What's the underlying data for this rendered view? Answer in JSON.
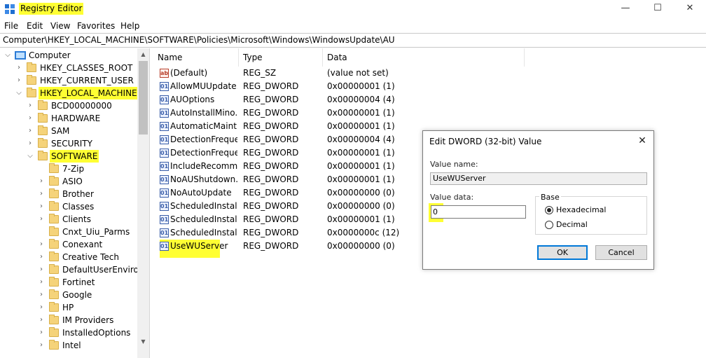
{
  "window": {
    "title": "Registry Editor",
    "minimize": "—",
    "maximize": "☐",
    "close": "✕"
  },
  "menu": [
    "File",
    "Edit",
    "View",
    "Favorites",
    "Help"
  ],
  "address": "Computer\\HKEY_LOCAL_MACHINE\\SOFTWARE\\Policies\\Microsoft\\Windows\\WindowsUpdate\\AU",
  "tree": {
    "root": "Computer",
    "hives": [
      "HKEY_CLASSES_ROOT",
      "HKEY_CURRENT_USER",
      "HKEY_LOCAL_MACHINE"
    ],
    "hklm_children": [
      "BCD00000000",
      "HARDWARE",
      "SAM",
      "SECURITY",
      "SOFTWARE"
    ],
    "software_children": [
      "7-Zip",
      "ASIO",
      "Brother",
      "Classes",
      "Clients",
      "Cnxt_Uiu_Parms",
      "Conexant",
      "Creative Tech",
      "DefaultUserEnvironn",
      "Fortinet",
      "Google",
      "HP",
      "IM Providers",
      "InstalledOptions",
      "Intel"
    ]
  },
  "columns": {
    "name": "Name",
    "type": "Type",
    "data": "Data"
  },
  "values": [
    {
      "name": "(Default)",
      "type": "REG_SZ",
      "data": "(value not set)",
      "icon": "string-value-icon"
    },
    {
      "name": "AllowMUUpdate...",
      "type": "REG_DWORD",
      "data": "0x00000001 (1)",
      "icon": "dword-value-icon"
    },
    {
      "name": "AUOptions",
      "type": "REG_DWORD",
      "data": "0x00000004 (4)",
      "icon": "dword-value-icon"
    },
    {
      "name": "AutoInstallMino...",
      "type": "REG_DWORD",
      "data": "0x00000001 (1)",
      "icon": "dword-value-icon"
    },
    {
      "name": "AutomaticMaint...",
      "type": "REG_DWORD",
      "data": "0x00000001 (1)",
      "icon": "dword-value-icon"
    },
    {
      "name": "DetectionFreque...",
      "type": "REG_DWORD",
      "data": "0x00000004 (4)",
      "icon": "dword-value-icon"
    },
    {
      "name": "DetectionFreque...",
      "type": "REG_DWORD",
      "data": "0x00000001 (1)",
      "icon": "dword-value-icon"
    },
    {
      "name": "IncludeRecomm...",
      "type": "REG_DWORD",
      "data": "0x00000001 (1)",
      "icon": "dword-value-icon"
    },
    {
      "name": "NoAUShutdown...",
      "type": "REG_DWORD",
      "data": "0x00000001 (1)",
      "icon": "dword-value-icon"
    },
    {
      "name": "NoAutoUpdate",
      "type": "REG_DWORD",
      "data": "0x00000000 (0)",
      "icon": "dword-value-icon"
    },
    {
      "name": "ScheduledInstall...",
      "type": "REG_DWORD",
      "data": "0x00000000 (0)",
      "icon": "dword-value-icon"
    },
    {
      "name": "ScheduledInstall...",
      "type": "REG_DWORD",
      "data": "0x00000001 (1)",
      "icon": "dword-value-icon"
    },
    {
      "name": "ScheduledInstall...",
      "type": "REG_DWORD",
      "data": "0x0000000c (12)",
      "icon": "dword-value-icon"
    },
    {
      "name": "UseWUServer",
      "type": "REG_DWORD",
      "data": "0x00000000 (0)",
      "icon": "dword-value-icon"
    }
  ],
  "dialog": {
    "title": "Edit DWORD (32-bit) Value",
    "close": "✕",
    "value_name_label": "Value name:",
    "value_name": "UseWUServer",
    "value_data_label": "Value data:",
    "value_data": "0",
    "base_label": "Base",
    "hex_label": "Hexadecimal",
    "dec_label": "Decimal",
    "ok": "OK",
    "cancel": "Cancel"
  },
  "colors": {
    "highlight": "#ffff33",
    "accent": "#0078d7"
  }
}
